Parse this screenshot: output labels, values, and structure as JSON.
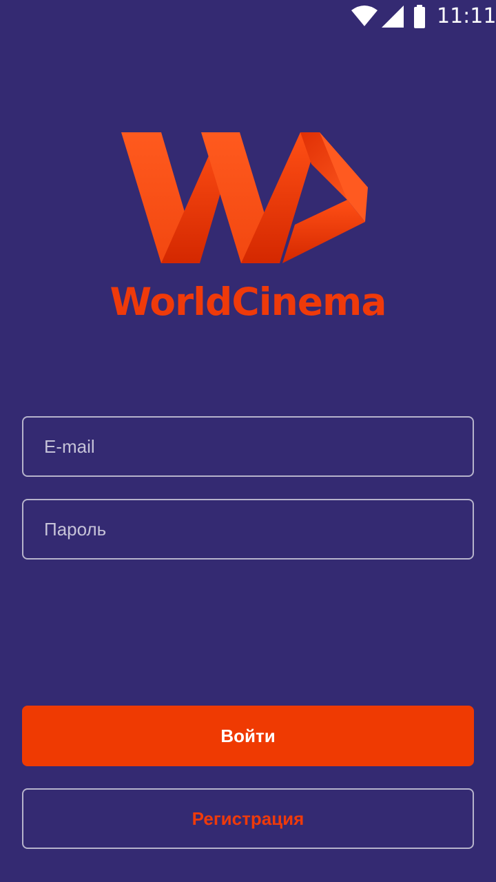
{
  "status_bar": {
    "time": "11:11",
    "icons": [
      "wifi-icon",
      "signal-icon",
      "battery-icon"
    ]
  },
  "brand": {
    "name": "WorldCinema",
    "color": "#ef3a0a"
  },
  "form": {
    "email_placeholder": "E-mail",
    "password_placeholder": "Пароль"
  },
  "actions": {
    "login_label": "Войти",
    "register_label": "Регистрация"
  },
  "colors": {
    "background": "#342a72",
    "accent": "#ef3a02",
    "field_border": "#b7b4cc"
  }
}
